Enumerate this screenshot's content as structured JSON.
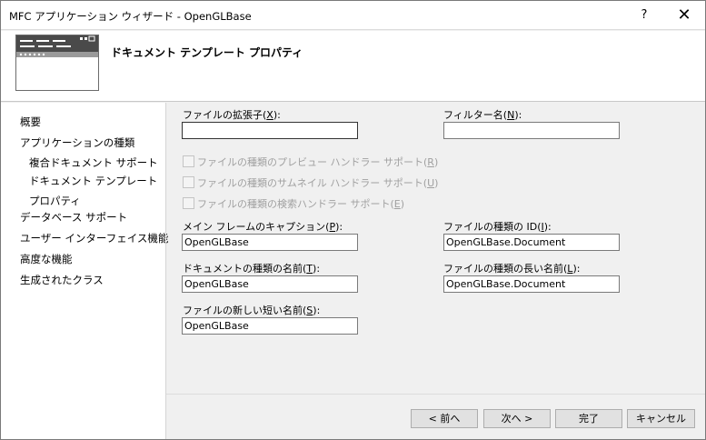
{
  "window": {
    "title": "MFC アプリケーション ウィザード - OpenGLBase",
    "help": "?",
    "close": "✕"
  },
  "banner": {
    "heading": "ドキュメント テンプレート プロパティ"
  },
  "nav": {
    "items": [
      {
        "label": "概要"
      },
      {
        "label": "アプリケーションの種類"
      },
      {
        "label": "複合ドキュメント サポート"
      },
      {
        "label": "ドキュメント テンプレート プロパティ"
      },
      {
        "label": "データベース サポート"
      },
      {
        "label": "ユーザー インターフェイス機能"
      },
      {
        "label": "高度な機能"
      },
      {
        "label": "生成されたクラス"
      }
    ]
  },
  "form": {
    "ext": {
      "label_pre": "ファイルの拡張子(",
      "key": "X",
      "label_post": "):",
      "value": ""
    },
    "filter": {
      "label_pre": "フィルター名(",
      "key": "N",
      "label_post": "):",
      "value": ""
    },
    "chk_preview": {
      "label_pre": "ファイルの種類のプレビュー ハンドラー サポート(",
      "key": "R",
      "label_post": ")"
    },
    "chk_thumbnail": {
      "label_pre": "ファイルの種類のサムネイル ハンドラー サポート(",
      "key": "U",
      "label_post": ")"
    },
    "chk_search": {
      "label_pre": "ファイルの種類の検索ハンドラー サポート(",
      "key": "E",
      "label_post": ")"
    },
    "caption": {
      "label_pre": "メイン フレームのキャプション(",
      "key": "P",
      "label_post": "):",
      "value": "OpenGLBase"
    },
    "typeid": {
      "label_pre": "ファイルの種類の ID(",
      "key": "I",
      "label_post": "):",
      "value": "OpenGLBase.Document"
    },
    "docname": {
      "label_pre": "ドキュメントの種類の名前(",
      "key": "T",
      "label_post": "):",
      "value": "OpenGLBase"
    },
    "longname": {
      "label_pre": "ファイルの種類の長い名前(",
      "key": "L",
      "label_post": "):",
      "value": "OpenGLBase.Document"
    },
    "shortname": {
      "label_pre": "ファイルの新しい短い名前(",
      "key": "S",
      "label_post": "):",
      "value": "OpenGLBase"
    }
  },
  "buttons": {
    "prev": "< 前へ",
    "next": "次へ >",
    "finish": "完了",
    "cancel": "キャンセル"
  }
}
